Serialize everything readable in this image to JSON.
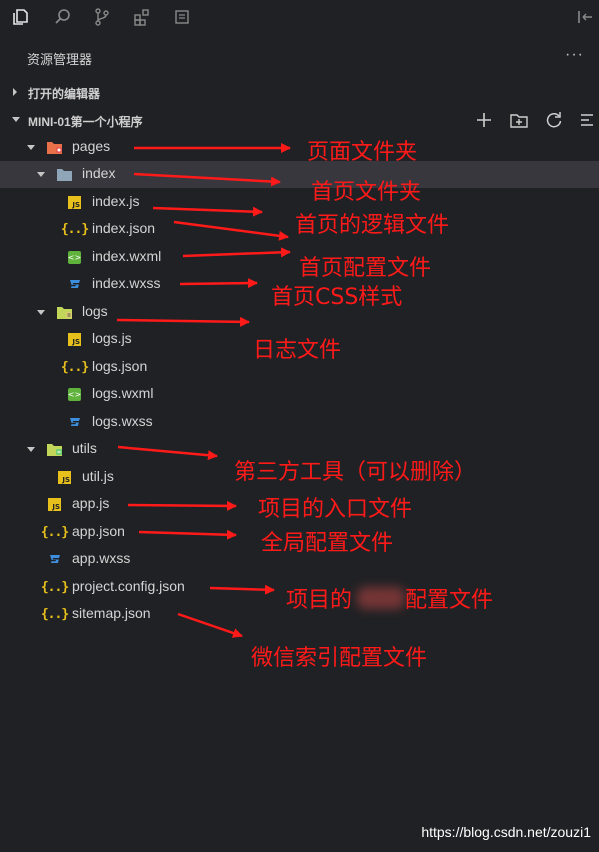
{
  "activity_bar": {
    "icons": [
      "files-icon",
      "search-icon",
      "source-control-icon",
      "extensions-icon",
      "remote-icon",
      "collapse-panel-icon"
    ]
  },
  "explorer": {
    "title": "资源管理器",
    "more": "···",
    "open_editors": {
      "label": "打开的编辑器"
    },
    "project": {
      "label": "MINI-01第一个小程序",
      "actions": [
        "new-file-icon",
        "new-folder-icon",
        "refresh-icon",
        "collapse-all-icon"
      ]
    },
    "tree": [
      {
        "name": "pages",
        "type": "folder-pages",
        "expanded": true
      },
      {
        "name": "index",
        "type": "folder",
        "expanded": true,
        "selected": true
      },
      {
        "name": "index.js",
        "type": "js"
      },
      {
        "name": "index.json",
        "type": "json"
      },
      {
        "name": "index.wxml",
        "type": "wxml"
      },
      {
        "name": "index.wxss",
        "type": "wxss"
      },
      {
        "name": "logs",
        "type": "folder-logs",
        "expanded": true
      },
      {
        "name": "logs.js",
        "type": "js"
      },
      {
        "name": "logs.json",
        "type": "json"
      },
      {
        "name": "logs.wxml",
        "type": "wxml"
      },
      {
        "name": "logs.wxss",
        "type": "wxss"
      },
      {
        "name": "utils",
        "type": "folder-utils",
        "expanded": true
      },
      {
        "name": "util.js",
        "type": "js"
      },
      {
        "name": "app.js",
        "type": "js"
      },
      {
        "name": "app.json",
        "type": "json"
      },
      {
        "name": "app.wxss",
        "type": "wxss"
      },
      {
        "name": "project.config.json",
        "type": "json"
      },
      {
        "name": "sitemap.json",
        "type": "json"
      }
    ]
  },
  "annotations": [
    "页面文件夹",
    "首页文件夹",
    "首页的逻辑文件",
    "首页配置文件",
    "首页CSS样式",
    "日志文件",
    "第三方工具（可以删除）",
    "项目的入口文件",
    "全局配置文件",
    "项目的",
    "配置文件",
    "微信索引配置文件"
  ],
  "colors": {
    "background": "#202124",
    "selected_row": "#37373d",
    "annotation": "#ff1a1a",
    "js_icon": "#e8c01c",
    "wxss_icon": "#3d8fe0",
    "wxml_icon": "#5fb23b"
  },
  "watermark": "https://blog.csdn.net/zouzi1"
}
